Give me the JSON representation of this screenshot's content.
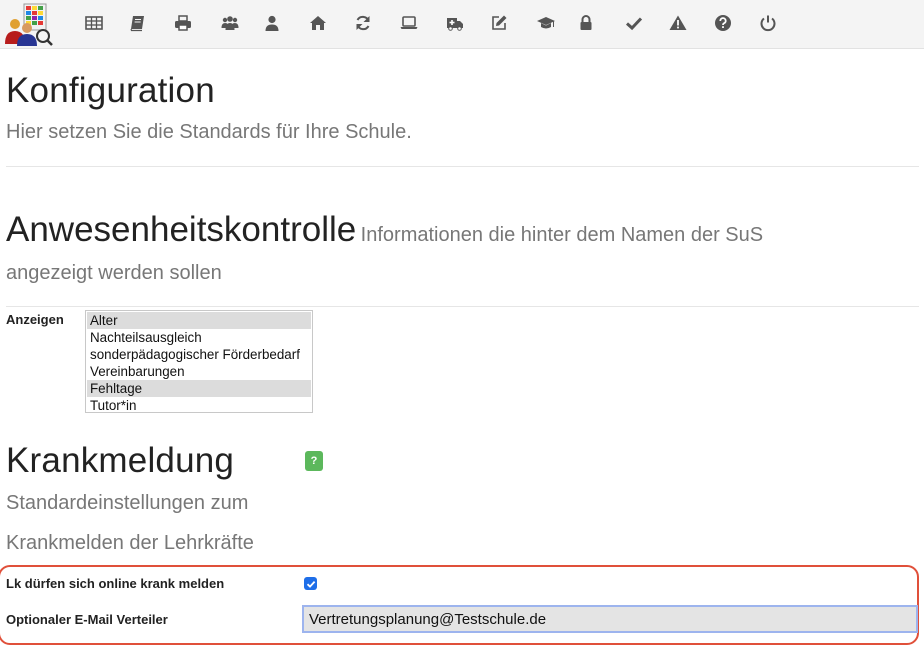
{
  "toolbar": {
    "logo": "school-logo",
    "icons": [
      "table-icon",
      "book-icon",
      "print-icon",
      "users-icon",
      "user-icon",
      "home-icon",
      "refresh-icon",
      "laptop-icon",
      "ambulance-icon",
      "edit-icon",
      "graduation-cap-icon",
      "lock-icon",
      "check-icon",
      "warning-icon",
      "help-icon",
      "power-icon"
    ]
  },
  "page": {
    "title": "Konfiguration",
    "subtitle": "Hier setzen Sie die Standards für Ihre Schule."
  },
  "attendance": {
    "title": "Anwesenheitskontrolle",
    "subtitle_line1": "Informationen die hinter dem Namen der SuS",
    "subtitle_line2": "angezeigt werden sollen",
    "show_label": "Anzeigen",
    "options": [
      {
        "label": "Alter",
        "selected": true
      },
      {
        "label": "Nachteilsausgleich",
        "selected": false
      },
      {
        "label": "sonderpädagogischer Förderbedarf",
        "selected": false
      },
      {
        "label": "Vereinbarungen",
        "selected": false
      },
      {
        "label": "Fehltage",
        "selected": true
      },
      {
        "label": "Tutor*in",
        "selected": false
      }
    ]
  },
  "sick_report": {
    "title": "Krankmeldung",
    "help_badge": "?",
    "subtitle_line1": "Standardeinstellungen zum",
    "subtitle_line2": "Krankmelden der Lehrkräfte",
    "online_label": "Lk dürfen sich online krank melden",
    "online_checked": true,
    "email_label": "Optionaler E-Mail Verteiler",
    "email_value": "Vertretungsplanung@Testschule.de"
  },
  "colors": {
    "toolbar_bg": "#f4f4f4",
    "icon": "#555555",
    "highlight_border": "#e0503a",
    "checkbox": "#1e6ee8",
    "help_badge": "#5cb85c"
  }
}
